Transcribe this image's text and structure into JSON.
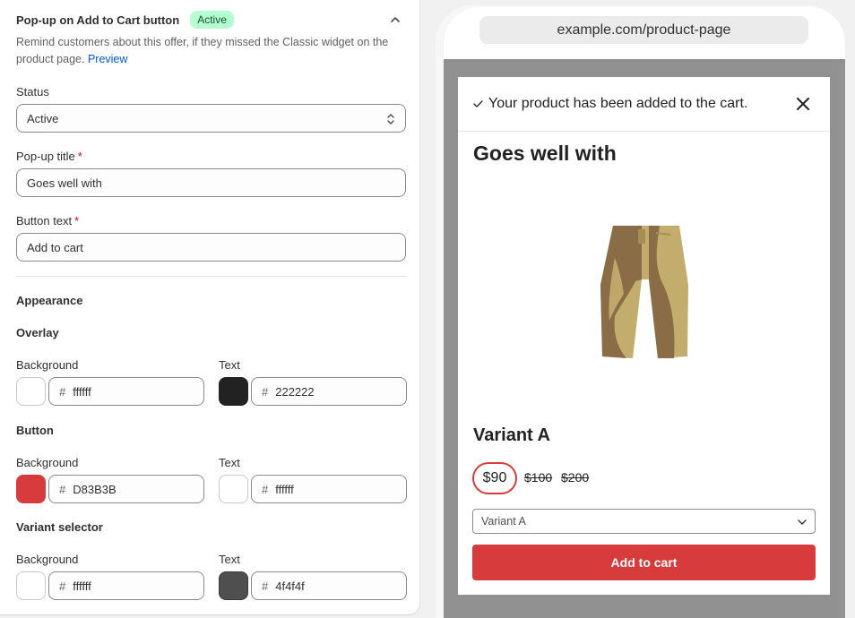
{
  "card": {
    "title": "Pop-up on Add to Cart button",
    "badge": "Active",
    "description": "Remind customers about this offer, if they missed the Classic widget on the product page.",
    "preview_link": "Preview",
    "collapse_icon": "chevron-up-icon"
  },
  "form": {
    "status_label": "Status",
    "status_value": "Active",
    "popup_title_label": "Pop-up title",
    "popup_title_value": "Goes well with",
    "button_text_label": "Button text",
    "button_text_value": "Add to cart",
    "required_mark": "*"
  },
  "appearance": {
    "heading": "Appearance",
    "hash": "#",
    "sections": [
      {
        "title": "Overlay",
        "background_label": "Background",
        "background_hex": "ffffff",
        "background_color": "#ffffff",
        "text_label": "Text",
        "text_hex": "222222",
        "text_color": "#222222"
      },
      {
        "title": "Button",
        "background_label": "Background",
        "background_hex": "D83B3B",
        "background_color": "#D83B3B",
        "text_label": "Text",
        "text_hex": "ffffff",
        "text_color": "#ffffff"
      },
      {
        "title": "Variant selector",
        "background_label": "Background",
        "background_hex": "ffffff",
        "background_color": "#ffffff",
        "text_label": "Text",
        "text_hex": "4f4f4f",
        "text_color": "#4f4f4f"
      }
    ]
  },
  "preview": {
    "url": "example.com/product-page",
    "toast": "Your product has been added to the cart.",
    "toast_icon": "checkmark-icon",
    "close_icon": "close-icon",
    "popup_title": "Goes well with",
    "product_image": "shorts-product-image",
    "variant_title": "Variant A",
    "price": "$90",
    "compare_prices": [
      "$100",
      "$200"
    ],
    "variant_option": "Variant A",
    "add_to_cart": "Add to cart"
  }
}
